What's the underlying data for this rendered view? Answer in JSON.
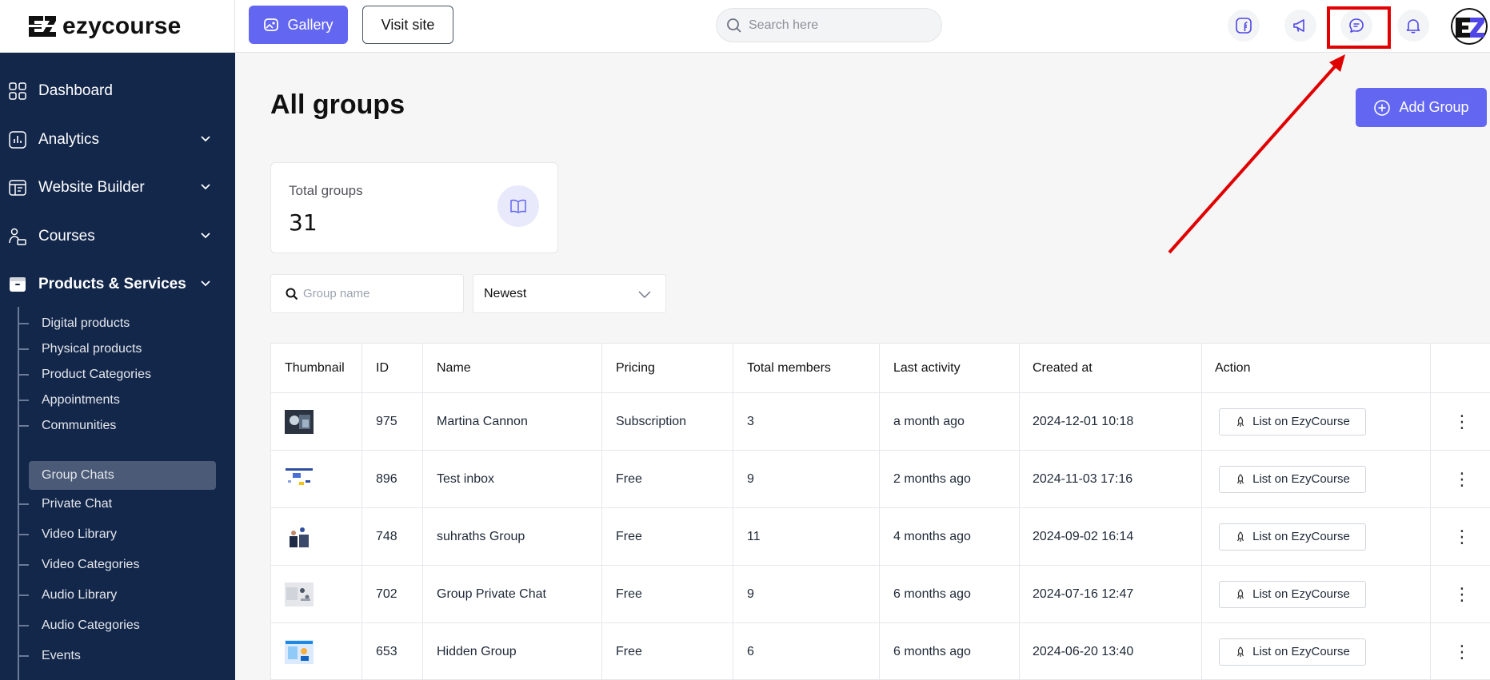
{
  "brand": {
    "name": "ezycourse"
  },
  "topbar": {
    "gallery_label": "Gallery",
    "visit_label": "Visit site",
    "search_placeholder": "Search here",
    "icons": [
      "facebook-icon",
      "megaphone-icon",
      "chat-icon",
      "bell-icon"
    ],
    "highlighted_icon": "chat-icon",
    "accent_color": "#6366f1",
    "highlight_color": "#e00000"
  },
  "sidebar": {
    "items": [
      {
        "label": "Dashboard",
        "icon": "dashboard-icon",
        "expandable": false
      },
      {
        "label": "Analytics",
        "icon": "analytics-icon",
        "expandable": true
      },
      {
        "label": "Website Builder",
        "icon": "website-builder-icon",
        "expandable": true
      },
      {
        "label": "Courses",
        "icon": "courses-icon",
        "expandable": true
      },
      {
        "label": "Products & Services",
        "icon": "box-icon",
        "expandable": true,
        "expanded": true
      }
    ],
    "sub_items": [
      {
        "label": "Digital products"
      },
      {
        "label": "Physical products"
      },
      {
        "label": "Product Categories"
      },
      {
        "label": "Appointments"
      },
      {
        "label": "Communities"
      },
      {
        "label": "Group Chats",
        "active": true
      },
      {
        "label": "Private Chat"
      },
      {
        "label": "Video Library"
      },
      {
        "label": "Video Categories"
      },
      {
        "label": "Audio Library"
      },
      {
        "label": "Audio Categories"
      },
      {
        "label": "Events"
      }
    ]
  },
  "main": {
    "title": "All groups",
    "add_label": "Add Group",
    "stat": {
      "label": "Total groups",
      "value": "31"
    },
    "filter": {
      "search_placeholder": "Group name",
      "sort_value": "Newest"
    },
    "table": {
      "headers": [
        "Thumbnail",
        "ID",
        "Name",
        "Pricing",
        "Total members",
        "Last activity",
        "Created at",
        "Action"
      ],
      "action_label": "List on EzyCourse",
      "rows": [
        {
          "id": "975",
          "name": "Martina Cannon",
          "pricing": "Subscription",
          "members": "3",
          "last_activity": "a month ago",
          "created": "2024-12-01 10:18"
        },
        {
          "id": "896",
          "name": "Test inbox",
          "pricing": "Free",
          "members": "9",
          "last_activity": "2 months ago",
          "created": "2024-11-03 17:16"
        },
        {
          "id": "748",
          "name": "suhraths Group",
          "pricing": "Free",
          "members": "11",
          "last_activity": "4 months ago",
          "created": "2024-09-02 16:14"
        },
        {
          "id": "702",
          "name": "Group Private Chat",
          "pricing": "Free",
          "members": "9",
          "last_activity": "6 months ago",
          "created": "2024-07-16 12:47"
        },
        {
          "id": "653",
          "name": "Hidden Group",
          "pricing": "Free",
          "members": "6",
          "last_activity": "6 months ago",
          "created": "2024-06-20 13:40"
        }
      ]
    }
  }
}
